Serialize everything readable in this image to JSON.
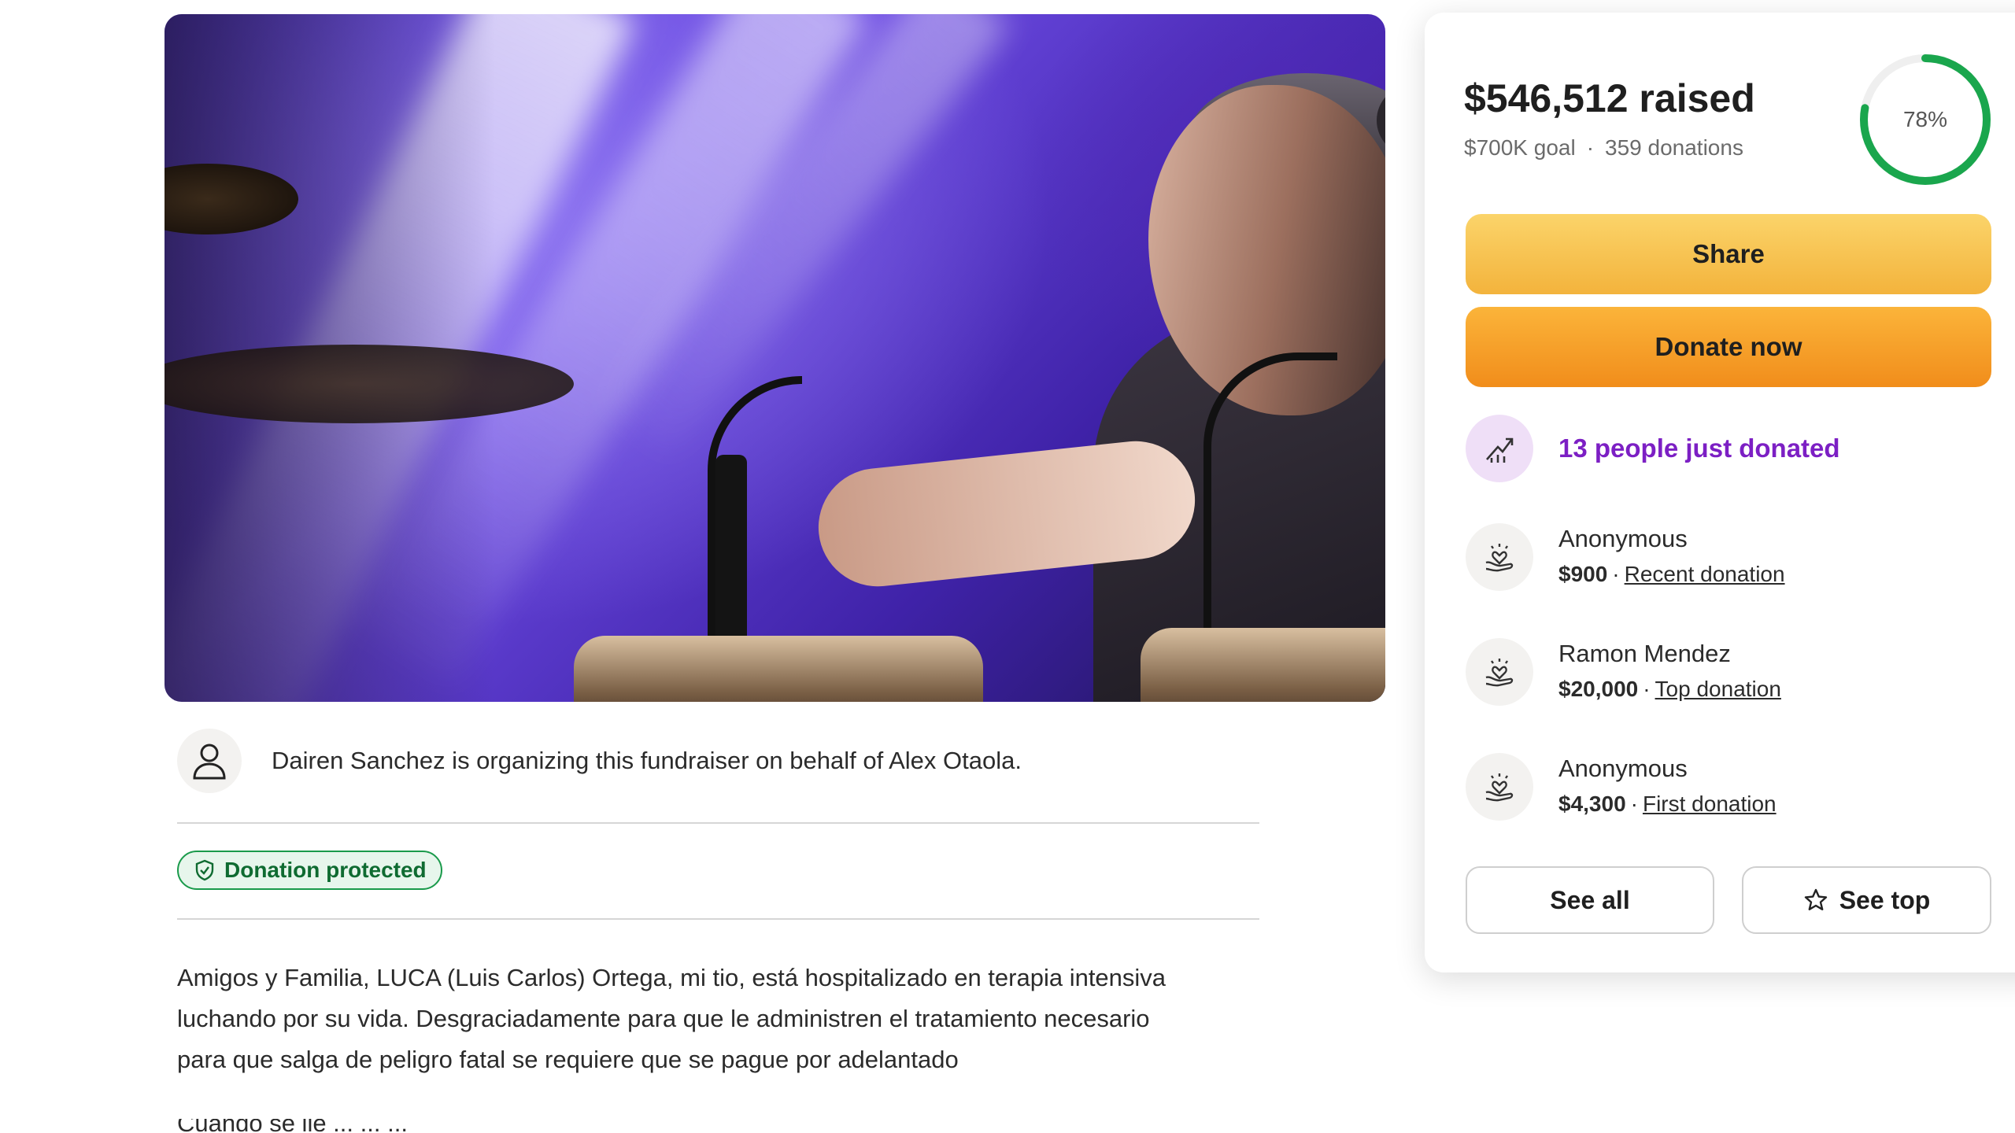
{
  "fundraiser": {
    "organizer_text": "Dairen Sanchez is organizing this fundraiser on behalf of Alex Otaola.",
    "badge_label": "Donation protected",
    "story_paragraphs": [
      "Amigos y Familia, LUCA (Luis Carlos) Ortega, mi tio, está hospitalizado en terapia intensiva",
      "luchando por su vida. Desgraciadamente para que le administren el tratamiento necesario",
      "para que salga de peligro fatal se requiere que se pague por adelantado"
    ],
    "story_cutoff": "Cuando se lle  ...  ...  ..."
  },
  "donation_card": {
    "raised": "$546,512 raised",
    "goal": "$700K goal",
    "separator": "·",
    "donations_count": "359 donations",
    "progress_percent_label": "78%",
    "progress_fraction": 0.78,
    "share_label": "Share",
    "donate_label": "Donate now",
    "recent_activity": "13 people just donated",
    "donors": [
      {
        "name": "Anonymous",
        "amount": "$900",
        "separator": "·",
        "tag": "Recent donation"
      },
      {
        "name": "Ramon Mendez",
        "amount": "$20,000",
        "separator": "·",
        "tag": "Top donation"
      },
      {
        "name": "Anonymous",
        "amount": "$4,300",
        "separator": "·",
        "tag": "First donation"
      }
    ],
    "see_all_label": "See all",
    "see_top_label": "See top"
  },
  "colors": {
    "progress_green": "#1aa64d",
    "recent_purple": "#7c1fc4",
    "badge_green": "#0f6b31"
  },
  "icons": {
    "organizer": "person-outline-icon",
    "badge": "shield-check-icon",
    "recent": "trending-up-icon",
    "donor": "heart-hand-icon",
    "see_top": "star-outline-icon"
  }
}
